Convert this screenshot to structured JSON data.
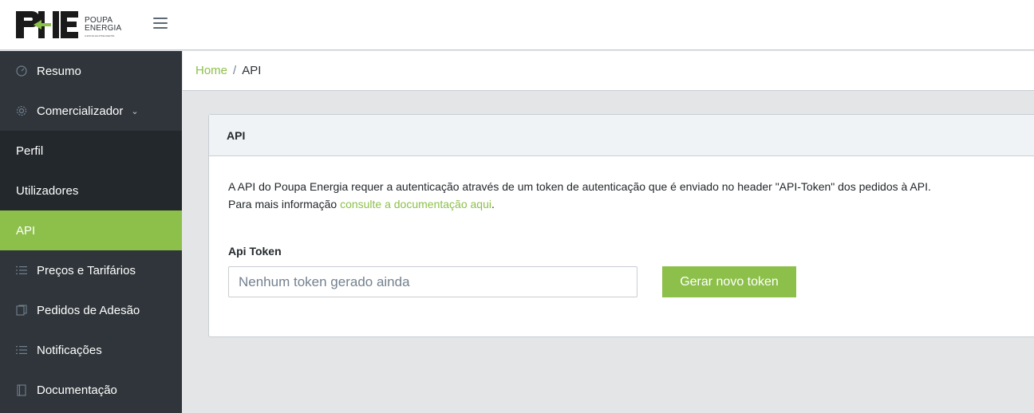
{
  "brand": {
    "line1": "POUPA",
    "line2": "ENERGIA",
    "tagline": "A ESCOLHA INTELIGENTE",
    "accent_color": "#8dc04a"
  },
  "topbar": {
    "menu_icon": "hamburger-icon"
  },
  "sidebar": {
    "items": [
      {
        "label": "Resumo",
        "icon": "speedometer-icon"
      },
      {
        "label": "Comercializador",
        "icon": "gear-icon",
        "caret": "⌄"
      },
      {
        "label": "Perfil"
      },
      {
        "label": "Utilizadores"
      },
      {
        "label": "API"
      },
      {
        "label": "Preços e Tarifários",
        "icon": "list-icon"
      },
      {
        "label": "Pedidos de Adesão",
        "icon": "docs-icon"
      },
      {
        "label": "Notificações",
        "icon": "list-icon"
      },
      {
        "label": "Documentação",
        "icon": "book-icon"
      }
    ]
  },
  "breadcrumb": {
    "home": "Home",
    "separator": "/",
    "current": "API"
  },
  "card": {
    "title": "API",
    "description": "A API do Poupa Energia requer a autenticação através de um token de autenticação que é enviado no header \"API-Token\" dos pedidos à API.",
    "more_info_prefix": "Para mais informação ",
    "more_info_link": "consulte a documentação aqui",
    "more_info_suffix": ".",
    "token_label": "Api Token",
    "token_placeholder": "Nenhum token gerado ainda",
    "generate_button": "Gerar novo token"
  }
}
